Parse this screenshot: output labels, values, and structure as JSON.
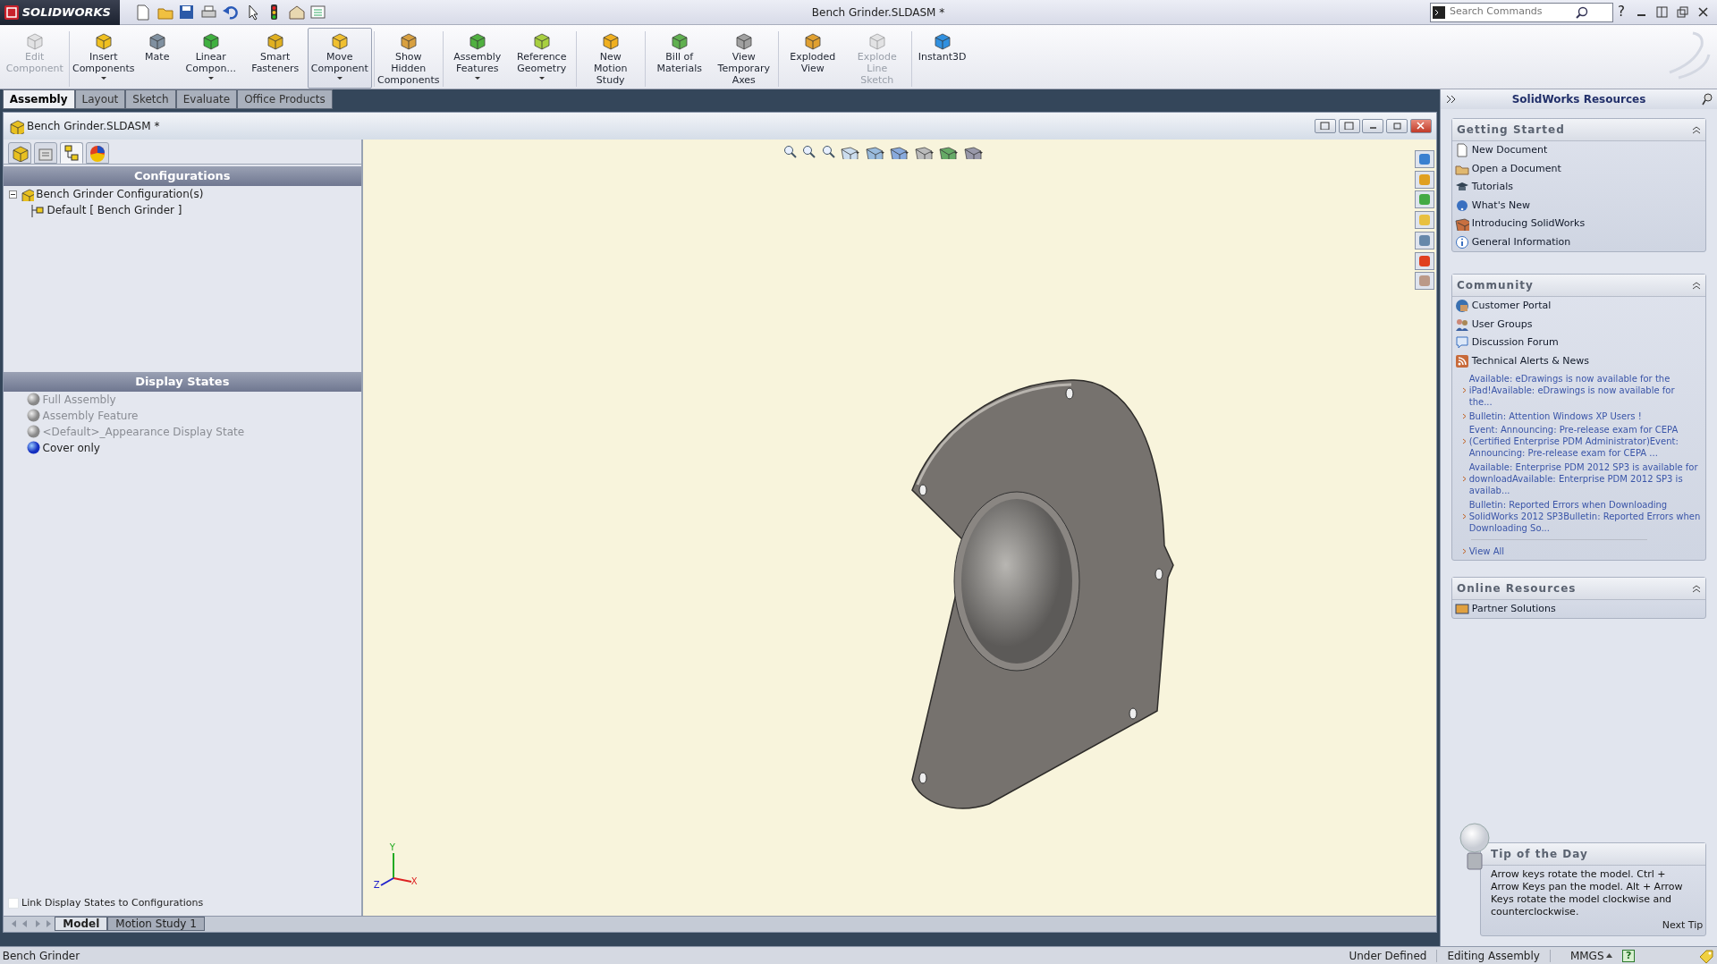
{
  "app": {
    "logo": "SOLIDWORKS",
    "title": "Bench Grinder.SLDASM *",
    "search": {
      "placeholder": "Search Commands"
    },
    "help": "?"
  },
  "ribbon": [
    {
      "label": "Edit Component",
      "disabled": true,
      "dropdown": false,
      "selected": false
    },
    {
      "label": "Insert Components",
      "disabled": false,
      "dropdown": true,
      "selected": false
    },
    {
      "label": "Mate",
      "disabled": false,
      "dropdown": false,
      "selected": false
    },
    {
      "label": "Linear Compon...",
      "disabled": false,
      "dropdown": true,
      "selected": false
    },
    {
      "label": "Smart Fasteners",
      "disabled": false,
      "dropdown": false,
      "selected": false
    },
    {
      "label": "Move Component",
      "disabled": false,
      "dropdown": true,
      "selected": true
    },
    {
      "label": "Show Hidden Components",
      "disabled": false,
      "dropdown": false,
      "selected": false
    },
    {
      "label": "Assembly Features",
      "disabled": false,
      "dropdown": true,
      "selected": false
    },
    {
      "label": "Reference Geometry",
      "disabled": false,
      "dropdown": true,
      "selected": false
    },
    {
      "label": "New Motion Study",
      "disabled": false,
      "dropdown": false,
      "selected": false
    },
    {
      "label": "Bill of Materials",
      "disabled": false,
      "dropdown": false,
      "selected": false
    },
    {
      "label": "View Temporary Axes",
      "disabled": false,
      "dropdown": false,
      "selected": false
    },
    {
      "label": "Exploded View",
      "disabled": false,
      "dropdown": false,
      "selected": false
    },
    {
      "label": "Explode Line Sketch",
      "disabled": true,
      "dropdown": false,
      "selected": false
    },
    {
      "label": "Instant3D",
      "disabled": false,
      "dropdown": false,
      "selected": false
    }
  ],
  "command_tabs": [
    {
      "label": "Assembly",
      "selected": true
    },
    {
      "label": "Layout",
      "selected": false
    },
    {
      "label": "Sketch",
      "selected": false
    },
    {
      "label": "Evaluate",
      "selected": false
    },
    {
      "label": "Office Products",
      "selected": false
    }
  ],
  "document": {
    "title": "Bench Grinder.SLDASM *"
  },
  "manager_tabs": [
    {
      "selected": false
    },
    {
      "selected": false
    },
    {
      "selected": true
    },
    {
      "selected": false
    }
  ],
  "configurations": {
    "heading": "Configurations",
    "tree": [
      {
        "label": "Bench Grinder Configuration(s)",
        "expanded": true,
        "children": [
          {
            "label": "Default [ Bench Grinder ]"
          }
        ]
      }
    ]
  },
  "display_states": {
    "heading": "Display States",
    "items": [
      {
        "label": "Full Assembly",
        "selected": false
      },
      {
        "label": "Assembly Feature",
        "selected": false
      },
      {
        "label": "<Default>_Appearance Display State",
        "selected": false
      },
      {
        "label": "Cover only",
        "selected": true
      }
    ]
  },
  "link_option": {
    "label": "Link Display States to Configurations",
    "checked": false
  },
  "triad": {
    "y": "Y",
    "z": "Z",
    "x": "X"
  },
  "bottom_tabs": [
    {
      "label": "Model",
      "selected": true
    },
    {
      "label": "Motion Study 1",
      "selected": false
    }
  ],
  "task_pane": {
    "title": "SolidWorks Resources",
    "sections": [
      {
        "heading": "Getting Started",
        "items": [
          "New Document",
          "Open a Document",
          "Tutorials",
          "What's New",
          "Introducing SolidWorks",
          "General Information"
        ]
      },
      {
        "heading": "Community",
        "items": [
          "Customer Portal",
          "User Groups",
          "Discussion Forum",
          "Technical Alerts & News"
        ],
        "news": [
          "Available: eDrawings is now available for the iPad!Available: eDrawings is now available for the...",
          "Bulletin: Attention Windows XP Users !",
          "Event: Announcing: Pre-release exam for CEPA (Certified Enterprise PDM Administrator)Event: Announcing: Pre-release exam for CEPA ...",
          "Available: Enterprise PDM 2012 SP3 is available for downloadAvailable: Enterprise PDM 2012 SP3 is availab...",
          "Bulletin: Reported Errors when Downloading SolidWorks 2012 SP3Bulletin: Reported Errors when Downloading So..."
        ],
        "view_all": "View All"
      },
      {
        "heading": "Online Resources",
        "items": [
          "Partner Solutions"
        ]
      }
    ],
    "tip": {
      "heading": "Tip of the Day",
      "text": "Arrow keys rotate the model. Ctrl + Arrow Keys pan the model. Alt + Arrow Keys rotate the model clockwise and counterclockwise.",
      "next": "Next Tip"
    }
  },
  "status_bar": {
    "document": "Bench Grinder",
    "fields": [
      "Under Defined",
      "Editing Assembly"
    ],
    "units": "MMGS",
    "help": "?"
  }
}
